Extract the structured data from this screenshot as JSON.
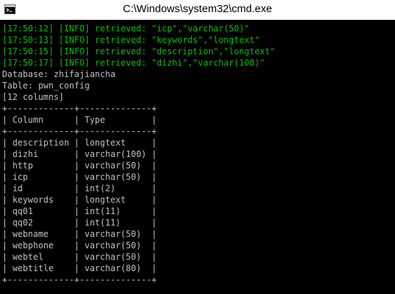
{
  "window": {
    "title": "C:\\Windows\\system32\\cmd.exe",
    "icon": "cmd-console-icon"
  },
  "colors": {
    "background": "#000000",
    "log_text": "#00c000",
    "plain_text": "#c0c0c0",
    "titlebar": "#ffffff"
  },
  "console": {
    "log_lines": [
      "[17:50:12] [INFO] retrieved: \"icp\",\"varchar(50)\"",
      "[17:50:13] [INFO] retrieved: \"keywords\",\"longtext\"",
      "[17:50:15] [INFO] retrieved: \"description\",\"longtext\"",
      "[17:50:17] [INFO] retrieved: \"dizhi\",\"varchar(100)\""
    ],
    "database_line": "Database: zhifajiancha",
    "table_line": "Table: pwn_config",
    "columns_count_line": "[12 columns]",
    "table_border": "+-------------+--------------+",
    "header_row": "| Column      | Type         |",
    "rows": [
      "| description | longtext     |",
      "| dizhi       | varchar(100) |",
      "| http        | varchar(50)  |",
      "| icp         | varchar(50)  |",
      "| id          | int(2)       |",
      "| keywords    | longtext     |",
      "| qq01        | int(11)      |",
      "| qq02        | int(11)      |",
      "| webname     | varchar(50)  |",
      "| webphone    | varchar(50)  |",
      "| webtel      | varchar(50)  |",
      "| webtitle    | varchar(80)  |"
    ]
  }
}
